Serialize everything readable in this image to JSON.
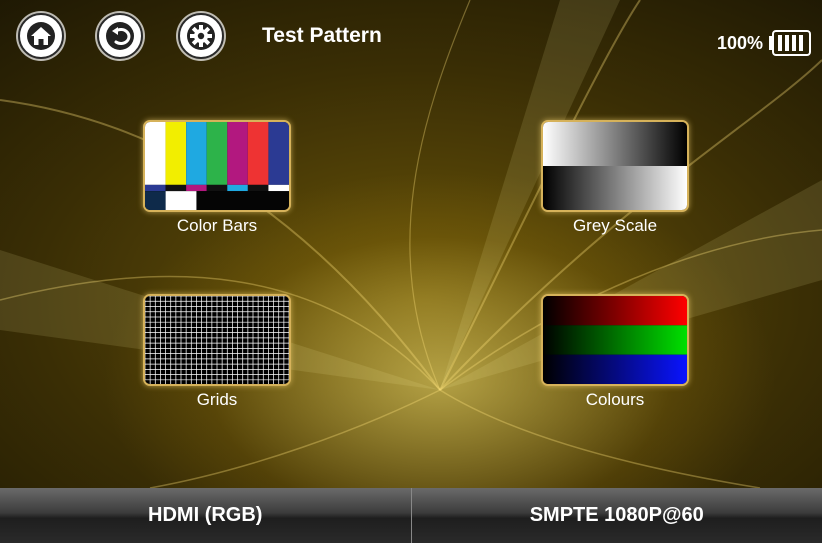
{
  "header": {
    "title": "Test Pattern",
    "home_icon": "home-icon",
    "back_icon": "back-icon",
    "settings_icon": "gear-icon"
  },
  "battery": {
    "percent_text": "100%",
    "level": 1.0
  },
  "patterns": [
    {
      "label": "Color Bars",
      "icon": "color-bars-thumbnail"
    },
    {
      "label": "Grey Scale",
      "icon": "grey-scale-thumbnail"
    },
    {
      "label": "Grids",
      "icon": "grids-thumbnail"
    },
    {
      "label": "Colours",
      "icon": "colours-thumbnail"
    }
  ],
  "bottom_bar": {
    "output_mode": "HDMI (RGB)",
    "video_format": "SMPTE 1080P@60"
  },
  "colors": {
    "background": "#3a2e05",
    "tile_border": "#d6b25a",
    "bar_colors": [
      "#ffffff",
      "#f2ee00",
      "#1fa9e1",
      "#2db34a",
      "#b2187f",
      "#ee3333",
      "#2b3a93"
    ]
  }
}
